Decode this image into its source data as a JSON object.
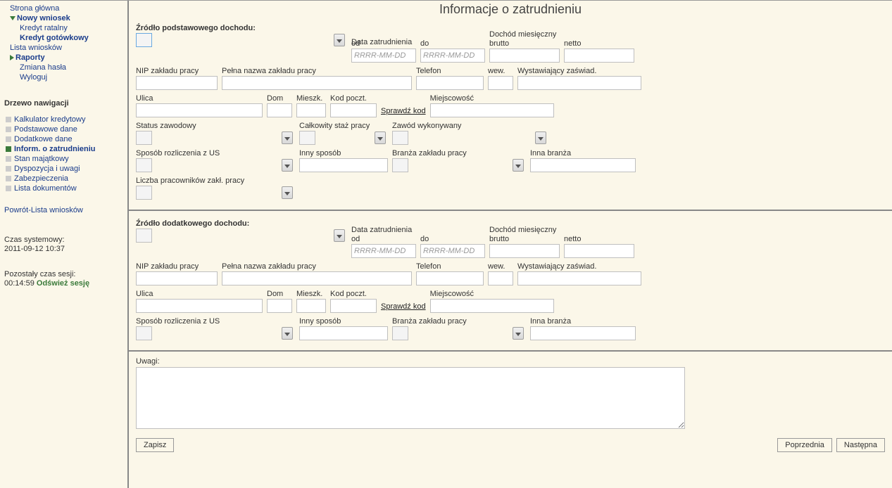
{
  "page": {
    "title": "Informacje o zatrudnieniu"
  },
  "nav": {
    "home": "Strona główna",
    "new_app": "Nowy wniosek",
    "installment": "Kredyt ratalny",
    "cash_loan": "Kredyt gotówkowy",
    "app_list": "Lista wniosków",
    "reports": "Raporty",
    "change_pass": "Zmiana hasła",
    "logout": "Wyloguj"
  },
  "tree": {
    "title": "Drzewo nawigacji",
    "items": [
      "Kalkulator kredytowy",
      "Podstawowe dane",
      "Dodatkowe dane",
      "Inform. o zatrudnieniu",
      "Stan majątkowy",
      "Dyspozycja i uwagi",
      "Zabezpieczenia",
      "Lista dokumentów"
    ],
    "active_index": 3
  },
  "back_link": "Powrót-Lista wniosków",
  "system": {
    "time_label": "Czas systemowy:",
    "time_value": "2011-09-12 10:37",
    "session_label": "Pozostały czas sesji:",
    "session_value": "00:14:59",
    "refresh": "Odśwież sesję"
  },
  "labels": {
    "primary_source": "Źródło podstawowego dochodu:",
    "additional_source": "Źródło dodatkowego dochodu:",
    "employment_date": "Data zatrudnienia",
    "from": "od",
    "to": "do",
    "monthly_income": "Dochód miesięczny",
    "gross": "brutto",
    "net": "netto",
    "date_placeholder": "RRRR-MM-DD",
    "employer_nip": "NIP zakładu pracy",
    "employer_full_name": "Pełna nazwa zakładu pracy",
    "phone": "Telefon",
    "ext": "wew.",
    "cert_issuer": "Wystawiający zaświad.",
    "street": "Ulica",
    "house": "Dom",
    "flat": "Mieszk.",
    "postcode": "Kod poczt.",
    "check_code": "Sprawdź kod",
    "city": "Miejscowość",
    "prof_status": "Status zawodowy",
    "total_seniority": "Całkowity staż pracy",
    "profession": "Zawód wykonywany",
    "tax_settlement": "Sposób rozliczenia z US",
    "other_method": "Inny sposób",
    "employer_industry": "Branża zakładu pracy",
    "other_industry": "Inna branża",
    "employee_count": "Liczba pracowników zakł. pracy",
    "notes": "Uwagi:"
  },
  "buttons": {
    "save": "Zapisz",
    "prev": "Poprzednia",
    "next": "Następna"
  }
}
